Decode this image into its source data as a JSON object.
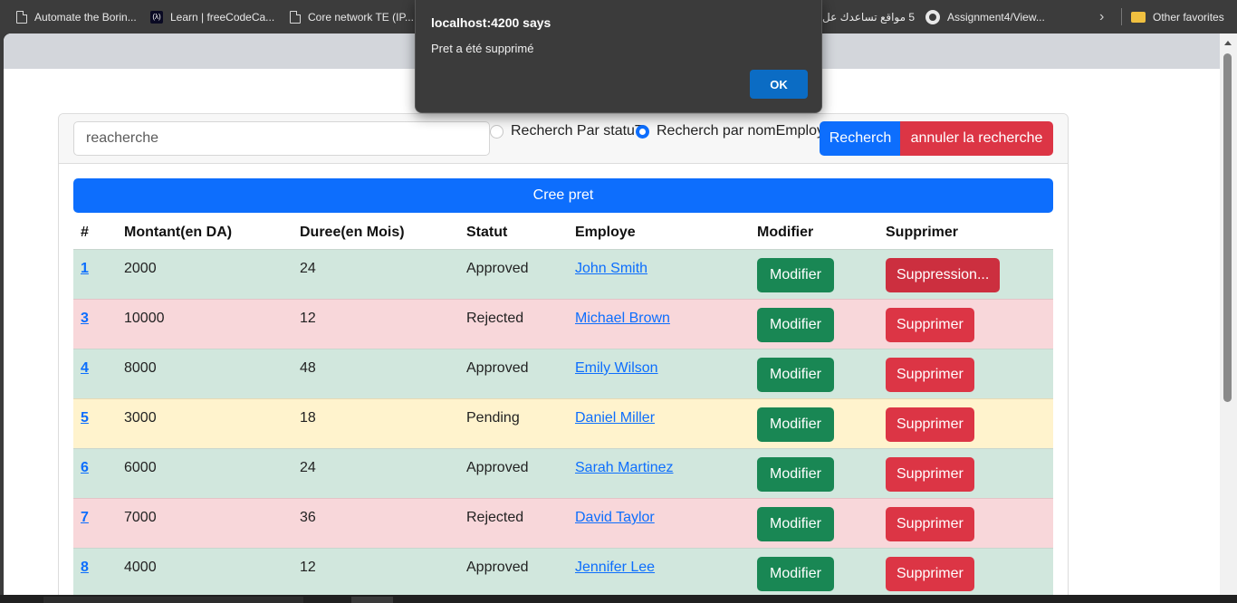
{
  "browser": {
    "bookmarks": [
      {
        "label": "Automate the Borin...",
        "icon": "document-icon"
      },
      {
        "label": "Learn | freeCodeCa...",
        "icon": "freecodecamp-icon"
      },
      {
        "label": "Core network TE (IP...",
        "icon": "document-icon"
      },
      {
        "label": "5 مواقع تساعدك عل",
        "icon": "document-icon"
      },
      {
        "label": "Assignment4/View...",
        "icon": "github-icon"
      },
      {
        "label": "Other favorites",
        "icon": "folder-icon"
      }
    ],
    "fcc_icon_glyph": "(λ)",
    "chevron_glyph": "›"
  },
  "dialog": {
    "title": "localhost:4200 says",
    "message": "Pret a été supprimé",
    "ok_label": "OK"
  },
  "search": {
    "placeholder": "reacherche",
    "radio_statut_label": "Recherch Par statuT",
    "radio_nom_label": "Recherch par nomEmploye",
    "radio_selected": "nomEmploye",
    "search_button": "Recherch",
    "cancel_button": "annuler la recherche"
  },
  "create_button": "Cree pret",
  "table": {
    "columns": [
      "#",
      "Montant(en DA)",
      "Duree(en Mois)",
      "Statut",
      "Employe",
      "Modifier",
      "Supprimer"
    ],
    "rows": [
      {
        "id": "1",
        "montant": "2000",
        "duree": "24",
        "statut": "Approved",
        "employe": "John Smith",
        "modifier": "Modifier",
        "supprimer": "Suppression...",
        "color": "#d1e7dd"
      },
      {
        "id": "3",
        "montant": "10000",
        "duree": "12",
        "statut": "Rejected",
        "employe": "Michael Brown",
        "modifier": "Modifier",
        "supprimer": "Supprimer",
        "color": "#f8d7da"
      },
      {
        "id": "4",
        "montant": "8000",
        "duree": "48",
        "statut": "Approved",
        "employe": "Emily Wilson",
        "modifier": "Modifier",
        "supprimer": "Supprimer",
        "color": "#d1e7dd"
      },
      {
        "id": "5",
        "montant": "3000",
        "duree": "18",
        "statut": "Pending",
        "employe": "Daniel Miller",
        "modifier": "Modifier",
        "supprimer": "Supprimer",
        "color": "#fff3cd"
      },
      {
        "id": "6",
        "montant": "6000",
        "duree": "24",
        "statut": "Approved",
        "employe": "Sarah Martinez",
        "modifier": "Modifier",
        "supprimer": "Supprimer",
        "color": "#d1e7dd"
      },
      {
        "id": "7",
        "montant": "7000",
        "duree": "36",
        "statut": "Rejected",
        "employe": "David Taylor",
        "modifier": "Modifier",
        "supprimer": "Supprimer",
        "color": "#f8d7da"
      },
      {
        "id": "8",
        "montant": "4000",
        "duree": "12",
        "statut": "Approved",
        "employe": "Jennifer Lee",
        "modifier": "Modifier",
        "supprimer": "Supprimer",
        "color": "#d1e7dd"
      }
    ]
  },
  "colors": {
    "primary": "#0d6efd",
    "danger": "#dc3545",
    "success": "#198754",
    "dialog_bg": "#3b3b3b",
    "dialog_button": "#0b6cc4"
  }
}
